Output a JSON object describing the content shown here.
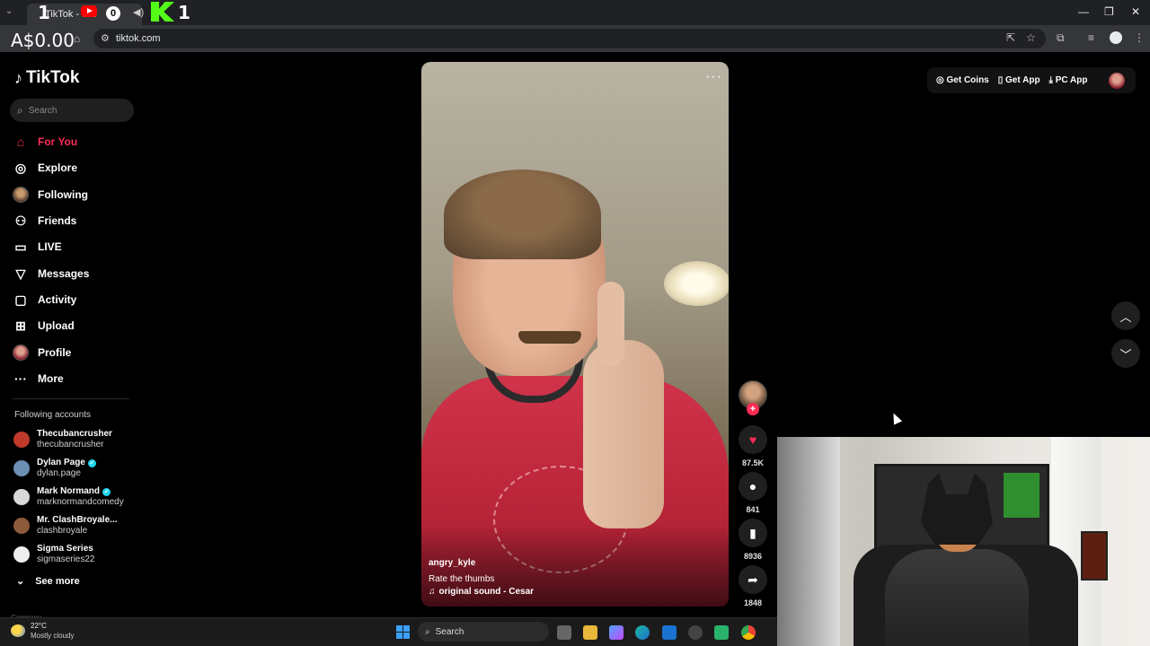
{
  "browser": {
    "tab_title": "TikTok - Ma",
    "badge_count": "0",
    "overlay_one_a": "1",
    "overlay_one_b": "1",
    "ad_overlay": "A$0.00",
    "url": "tiktok.com",
    "window_controls": {
      "minimize": "—",
      "maximize": "❐",
      "close": "✕"
    }
  },
  "sidebar": {
    "logo_text": "TikTok",
    "search_placeholder": "Search",
    "nav": [
      {
        "label": "For You",
        "icon": "home-icon"
      },
      {
        "label": "Explore",
        "icon": "compass-icon"
      },
      {
        "label": "Following",
        "icon": "following-avatar-icon"
      },
      {
        "label": "Friends",
        "icon": "friends-icon"
      },
      {
        "label": "LIVE",
        "icon": "live-icon"
      },
      {
        "label": "Messages",
        "icon": "messages-icon"
      },
      {
        "label": "Activity",
        "icon": "activity-icon"
      },
      {
        "label": "Upload",
        "icon": "upload-icon"
      },
      {
        "label": "Profile",
        "icon": "profile-avatar-icon"
      },
      {
        "label": "More",
        "icon": "more-icon"
      }
    ],
    "following_title": "Following accounts",
    "accounts": [
      {
        "name": "Thecubancrusher",
        "handle": "thecubancrusher",
        "verified": false,
        "color": "#c0392b"
      },
      {
        "name": "Dylan Page",
        "handle": "dylan.page",
        "verified": true,
        "color": "#6d8fb3"
      },
      {
        "name": "Mark Normand",
        "handle": "marknormandcomedy",
        "verified": true,
        "color": "#d8d8d8"
      },
      {
        "name": "Mr. ClashBroyale...",
        "handle": "clashbroyale",
        "verified": false,
        "color": "#8e5a3c"
      },
      {
        "name": "Sigma Series",
        "handle": "sigmaseries22",
        "verified": false,
        "color": "#eeeeee"
      }
    ],
    "see_more": "See more",
    "company": "Company"
  },
  "video": {
    "author": "angry_kyle",
    "caption": "Rate the thumbs",
    "sound": "original sound - Cesar"
  },
  "actions": {
    "likes": "87.5K",
    "comments": "841",
    "saves": "8936",
    "shares": "1848"
  },
  "topbar": {
    "get_coins": "Get Coins",
    "get_app": "Get App",
    "pc_app": "PC App"
  },
  "taskbar": {
    "temperature": "22°C",
    "weather": "Mostly cloudy",
    "search": "Search"
  },
  "colors": {
    "accent": "#fe2c55",
    "background": "#000000",
    "verified": "#20d5ec"
  }
}
